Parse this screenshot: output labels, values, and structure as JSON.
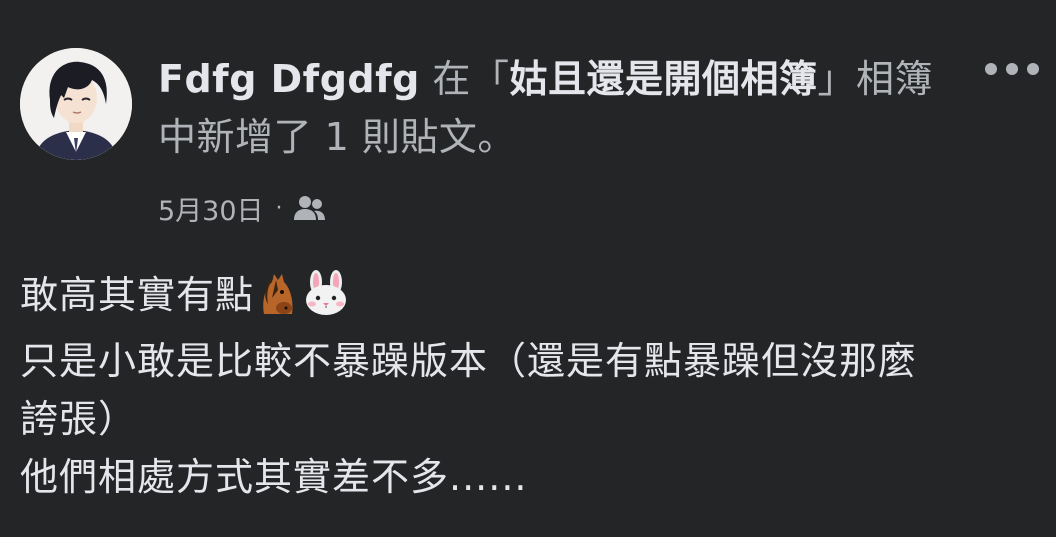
{
  "post": {
    "author_name": "Fdfg Dfgdfg",
    "header_prefix": " 在",
    "album_open_quote": "「",
    "album_name": "姑且還是開個相簿",
    "album_close_quote": "」",
    "header_suffix": "相簿中新增了 1 則貼文。",
    "timestamp": "5月30日",
    "separator": "·",
    "audience_icon": "friends-icon",
    "more_icon": "more-options-icon",
    "emojis": [
      "horse-face-emoji",
      "rabbit-face-emoji"
    ],
    "body_lines": [
      "敢高其實有點",
      "只是小敢是比較不暴躁版本（還是有點暴躁但沒那麼",
      "誇張）",
      "他們相處方式其實差不多......"
    ]
  }
}
